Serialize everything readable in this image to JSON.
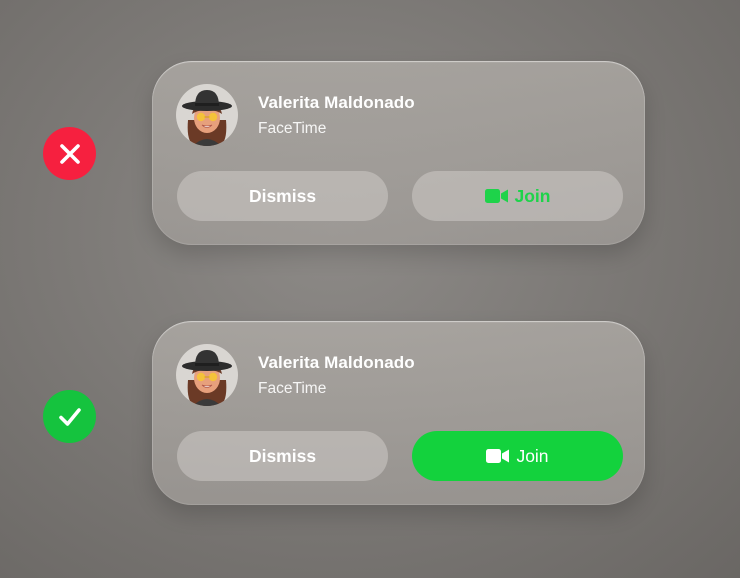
{
  "examples": [
    {
      "verdict_icon": "x-mark-icon",
      "verdict_color": "#f6203f",
      "notification": {
        "caller_name": "Valerita Maldonado",
        "app_name": "FaceTime",
        "dismiss_label": "Dismiss",
        "join_label": "Join",
        "join_icon": "video-camera-icon",
        "join_style": "text-green-on-grey",
        "accent_color": "#1ed34a"
      }
    },
    {
      "verdict_icon": "checkmark-icon",
      "verdict_color": "#15c33e",
      "notification": {
        "caller_name": "Valerita Maldonado",
        "app_name": "FaceTime",
        "dismiss_label": "Dismiss",
        "join_label": "Join",
        "join_icon": "video-camera-icon",
        "join_style": "white-on-green",
        "accent_color": "#13d23d"
      }
    }
  ]
}
